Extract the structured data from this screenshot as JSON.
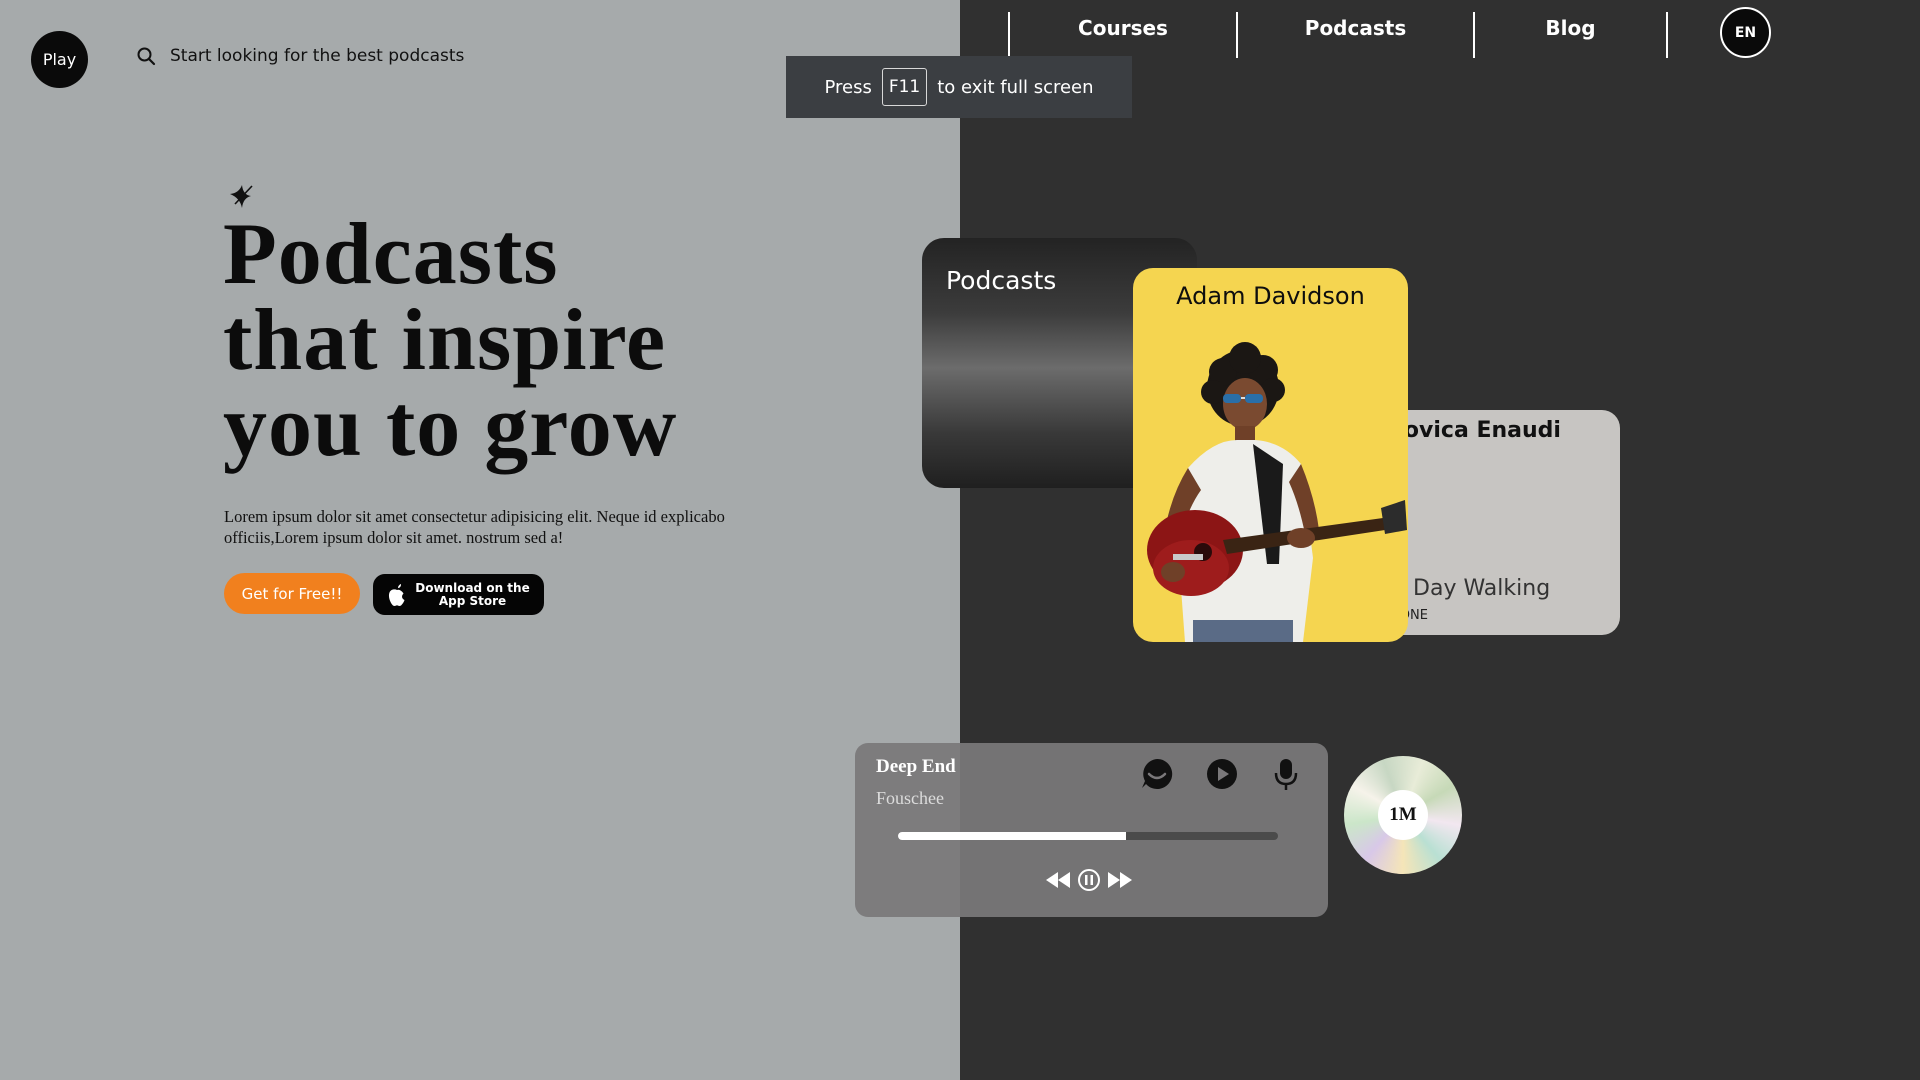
{
  "header": {
    "logo_text": "Play",
    "search_placeholder": "Start looking for the best podcasts",
    "nav": [
      "Courses",
      "Podcasts",
      "Blog"
    ],
    "language": "EN"
  },
  "fullscreen_notice": {
    "prefix": "Press",
    "key": "F11",
    "suffix": "to exit full screen"
  },
  "hero": {
    "headline": [
      "Podcasts",
      "that inspire",
      "you to grow"
    ],
    "description": "Lorem ipsum dolor sit amet consectetur adipisicing elit. Neque id explicabo officiis,Lorem ipsum dolor sit amet. nostrum sed a!",
    "cta_free": "Get for Free!!",
    "cta_store": [
      "Download on the",
      "App Store"
    ]
  },
  "cards": {
    "podcasts_label": "Podcasts",
    "featured_name": "Adam Davidson",
    "secondary_name": "uDovica Enaudi",
    "secondary_song": "otn Day Walking",
    "secondary_album": "DAT ONE"
  },
  "player": {
    "title": "Deep End",
    "artist": "Fouschee",
    "progress": 0.6
  },
  "disc": {
    "label": "1M"
  },
  "colors": {
    "left_bg": "#a6aaab",
    "right_bg": "#303030",
    "accent_orange": "#f1801e",
    "card_yellow": "#f5d550"
  }
}
